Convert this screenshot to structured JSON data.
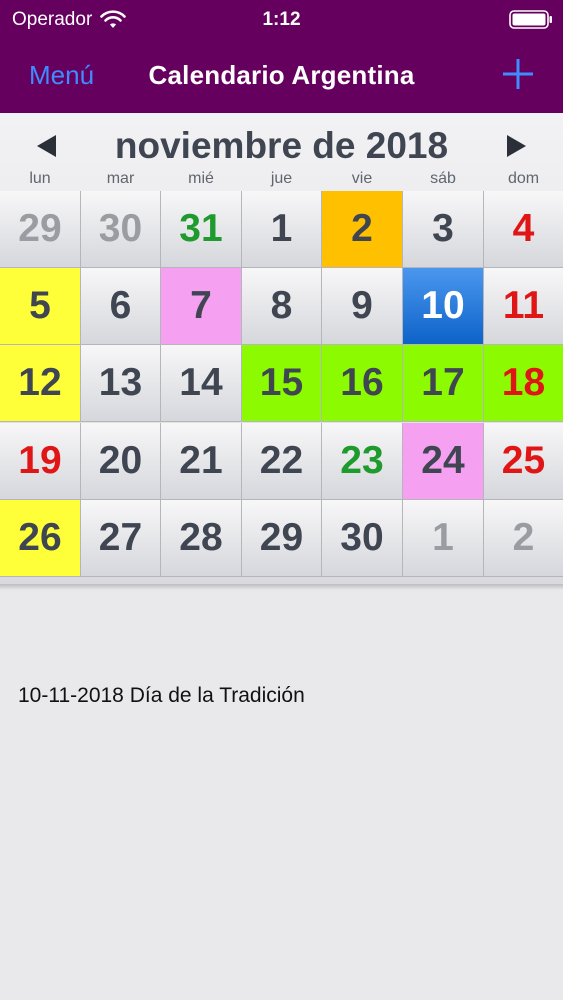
{
  "status": {
    "carrier": "Operador",
    "time": "1:12"
  },
  "nav": {
    "menu_label": "Menú",
    "title": "Calendario Argentina"
  },
  "calendar": {
    "month_label": "noviembre de 2018",
    "weekdays": [
      "lun",
      "mar",
      "mié",
      "jue",
      "vie",
      "sáb",
      "dom"
    ],
    "weeks": [
      [
        {
          "day": "29",
          "style": "muted"
        },
        {
          "day": "30",
          "style": "muted"
        },
        {
          "day": "31",
          "style": "green-text"
        },
        {
          "day": "1",
          "style": ""
        },
        {
          "day": "2",
          "style": "bg-orange"
        },
        {
          "day": "3",
          "style": ""
        },
        {
          "day": "4",
          "style": "red-text"
        }
      ],
      [
        {
          "day": "5",
          "style": "bg-yellow"
        },
        {
          "day": "6",
          "style": ""
        },
        {
          "day": "7",
          "style": "bg-pink"
        },
        {
          "day": "8",
          "style": ""
        },
        {
          "day": "9",
          "style": ""
        },
        {
          "day": "10",
          "style": "selected"
        },
        {
          "day": "11",
          "style": "red-text"
        }
      ],
      [
        {
          "day": "12",
          "style": "bg-yellow"
        },
        {
          "day": "13",
          "style": ""
        },
        {
          "day": "14",
          "style": ""
        },
        {
          "day": "15",
          "style": "bg-lime"
        },
        {
          "day": "16",
          "style": "bg-lime"
        },
        {
          "day": "17",
          "style": "bg-lime"
        },
        {
          "day": "18",
          "style": "bg-lime red-text"
        }
      ],
      [
        {
          "day": "19",
          "style": "red-text"
        },
        {
          "day": "20",
          "style": ""
        },
        {
          "day": "21",
          "style": ""
        },
        {
          "day": "22",
          "style": ""
        },
        {
          "day": "23",
          "style": "green-text"
        },
        {
          "day": "24",
          "style": "bg-pink"
        },
        {
          "day": "25",
          "style": "red-text"
        }
      ],
      [
        {
          "day": "26",
          "style": "bg-yellow"
        },
        {
          "day": "27",
          "style": ""
        },
        {
          "day": "28",
          "style": ""
        },
        {
          "day": "29",
          "style": ""
        },
        {
          "day": "30",
          "style": ""
        },
        {
          "day": "1",
          "style": "muted"
        },
        {
          "day": "2",
          "style": "muted"
        }
      ]
    ]
  },
  "event": {
    "text": "10-11-2018 Día de la Tradición"
  },
  "colors": {
    "header": "#66005f",
    "accent": "#3f8bff",
    "selected": "#0e63c9",
    "holiday_red": "#e01616",
    "green": "#1f9a2c"
  },
  "icons": {
    "wifi": "wifi-icon",
    "battery": "battery-icon",
    "add": "plus-icon",
    "prev": "chevron-left-icon",
    "next": "chevron-right-icon"
  }
}
